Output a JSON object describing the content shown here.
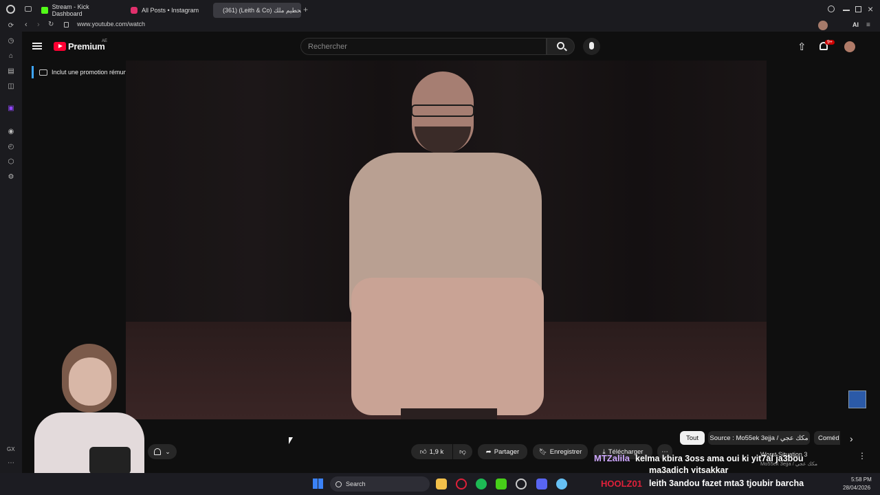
{
  "browser": {
    "tabs": [
      {
        "label": "Stream - Kick Dashboard",
        "color": "#53fc18"
      },
      {
        "label": "All Posts • Instagram",
        "color": "#e1306c"
      },
      {
        "label": "(361) (Leith & Co) تحطيم ملك",
        "color": "#ff0033"
      }
    ],
    "new_tab": "+",
    "url": "www.youtube.com/watch",
    "sidebar_label": "GX",
    "ai_label": "AI"
  },
  "youtube": {
    "logo_text": "Premium",
    "region": "AE",
    "search_placeholder": "Rechercher",
    "notif_badge": "9+",
    "promo_text": "Inclut une promotion rémunérée",
    "actions": {
      "like_count": "1,9 k",
      "share": "Partager",
      "save": "Enregistrer",
      "download": "Télécharger"
    },
    "chips": [
      "Tout",
      "Source : Mo55ek 3ejja / مكك عجي",
      "Coméd"
    ],
    "reco_title": "Worst Situation 3",
    "reco_channel": "Mo55ek 3ejja / مكك عجي"
  },
  "overlay_chat": {
    "user1": "MTZalila",
    "msg1_line1": "kelma kbira 3oss ama oui ki yit7al ja3bou",
    "msg1_line2": "ma3adich yitsakkar",
    "user2": "HOOLZ01",
    "msg2": "leith 3andou fazet mta3 tjoubir barcha"
  },
  "taskbar": {
    "search": "Search",
    "time": "5:58 PM",
    "date": "28/04/2026"
  },
  "colors": {
    "accent": "#ff0033",
    "chat_user1": "#cfa8ff",
    "chat_user2": "#e0203a"
  }
}
